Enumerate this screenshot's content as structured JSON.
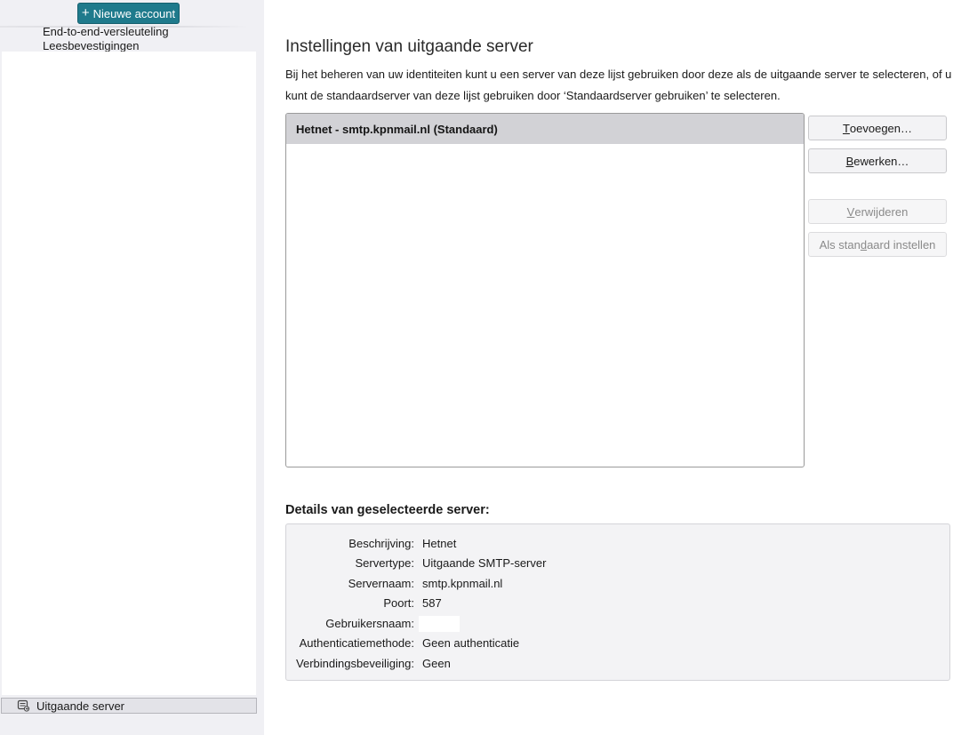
{
  "sidebar": {
    "new_account_label": "Nieuwe account",
    "items": [
      "End-to-end-versleuteling",
      "Leesbevestigingen"
    ],
    "selected_label": "Uitgaande server"
  },
  "main": {
    "title": "Instellingen van uitgaande server",
    "description": "Bij het beheren van uw identiteiten kunt u een server van deze lijst gebruiken door deze als de uitgaande server te selecteren, of u kunt de standaardserver van deze lijst gebruiken door ‘Standaardserver gebruiken’ te selecteren.",
    "servers": [
      "Hetnet - smtp.kpnmail.nl (Standaard)"
    ],
    "buttons": {
      "add": {
        "pre": "",
        "key": "T",
        "post": "oevoegen…"
      },
      "edit": {
        "pre": "",
        "key": "B",
        "post": "ewerken…"
      },
      "remove": {
        "pre": "",
        "key": "V",
        "post": "erwijderen"
      },
      "set_default": {
        "pre": "Als stan",
        "key": "d",
        "post": "aard instellen"
      }
    }
  },
  "details": {
    "title": "Details van geselecteerde server:",
    "rows": [
      {
        "label": "Beschrijving:",
        "value": "Hetnet"
      },
      {
        "label": "Servertype:",
        "value": "Uitgaande SMTP-server"
      },
      {
        "label": "Servernaam:",
        "value": "smtp.kpnmail.nl"
      },
      {
        "label": "Poort:",
        "value": "587"
      },
      {
        "label": "Gebruikersnaam:",
        "value": ""
      },
      {
        "label": "Authenticatiemethode:",
        "value": "Geen authenticatie"
      },
      {
        "label": "Verbindingsbeveiliging:",
        "value": "Geen"
      }
    ]
  },
  "icons": {
    "new_account": "plus-icon",
    "outgoing_server": "outgoing-server-icon"
  },
  "colors": {
    "accent": "#1f7a8c",
    "selected_row": "#d2d2d6"
  }
}
